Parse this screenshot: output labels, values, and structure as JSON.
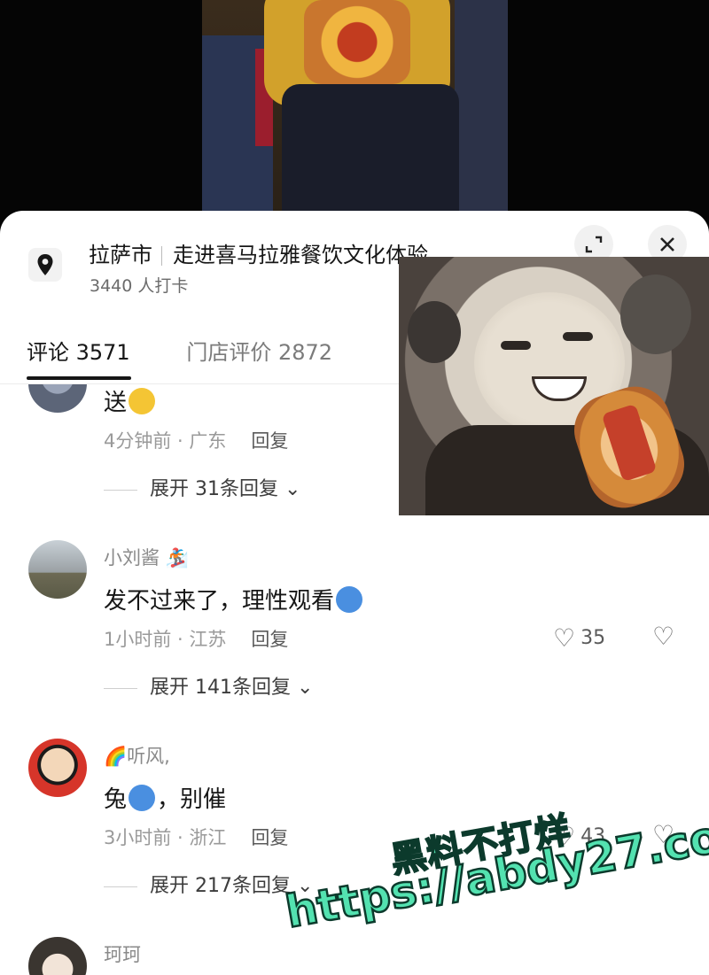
{
  "location": {
    "city": "拉萨市",
    "title": "走进喜马拉雅餐饮文化体验…",
    "checkins": "3440 人打卡"
  },
  "icons": {
    "location": "map-pin-icon",
    "expand": "expand-icon",
    "close": "close-icon",
    "like": "heart-icon",
    "dislike": "broken-heart-icon"
  },
  "tabs": [
    {
      "label": "评论 3571",
      "active": true
    },
    {
      "label": "门店评价 2872",
      "active": false
    }
  ],
  "comments": [
    {
      "user": "",
      "text": "送",
      "time": "4分钟前 · 广东",
      "reply": "回复",
      "expand": "展开 31条回复"
    },
    {
      "user": "小刘酱",
      "text": "发不过来了，理性观看",
      "time": "1小时前 · 江苏",
      "reply": "回复",
      "likes": "35",
      "expand": "展开 141条回复"
    },
    {
      "user": "听风,",
      "text_a": "兔",
      "text_b": "，别催",
      "time": "3小时前 · 浙江",
      "reply": "回复",
      "likes": "43",
      "expand": "展开 217条回复"
    },
    {
      "user": "珂珂"
    }
  ],
  "watermark": {
    "line1": "黑料不打烊",
    "line2": "https://abdy27.com"
  },
  "colors": {
    "watermark": "#53e2b0",
    "text_primary": "#161616",
    "text_secondary": "#8a8a8a"
  }
}
